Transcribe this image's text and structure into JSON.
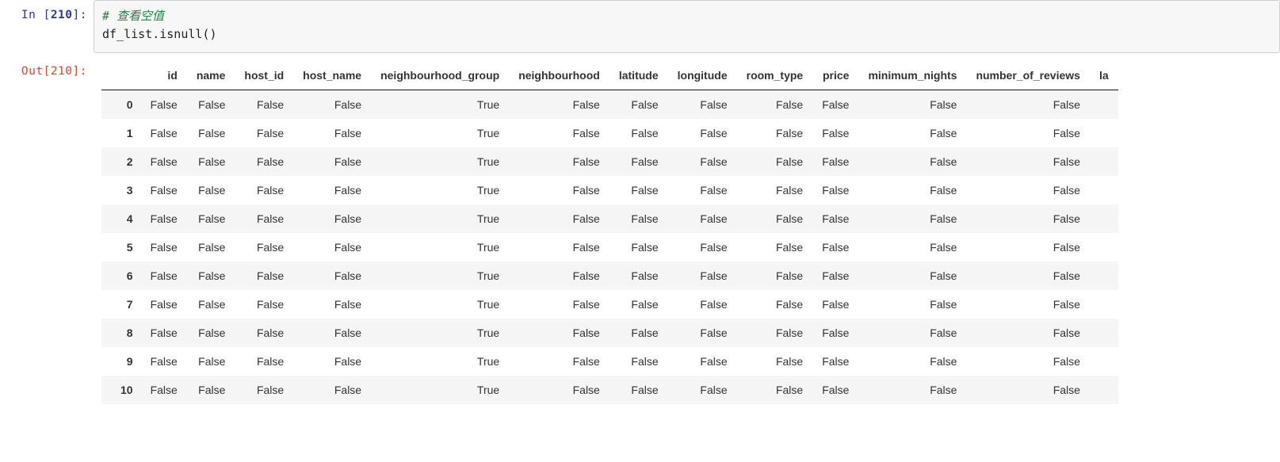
{
  "prompts": {
    "in_label": "In ",
    "out_label": "Out",
    "exec_count": "210"
  },
  "code": {
    "comment": "# 查看空值",
    "line": "df_list.isnull()"
  },
  "table": {
    "columns": [
      "id",
      "name",
      "host_id",
      "host_name",
      "neighbourhood_group",
      "neighbourhood",
      "latitude",
      "longitude",
      "room_type",
      "price",
      "minimum_nights",
      "number_of_reviews",
      "la"
    ],
    "index": [
      "0",
      "1",
      "2",
      "3",
      "4",
      "5",
      "6",
      "7",
      "8",
      "9",
      "10"
    ],
    "rows": [
      [
        "False",
        "False",
        "False",
        "False",
        "True",
        "False",
        "False",
        "False",
        "False",
        "False",
        "False",
        "False",
        ""
      ],
      [
        "False",
        "False",
        "False",
        "False",
        "True",
        "False",
        "False",
        "False",
        "False",
        "False",
        "False",
        "False",
        ""
      ],
      [
        "False",
        "False",
        "False",
        "False",
        "True",
        "False",
        "False",
        "False",
        "False",
        "False",
        "False",
        "False",
        ""
      ],
      [
        "False",
        "False",
        "False",
        "False",
        "True",
        "False",
        "False",
        "False",
        "False",
        "False",
        "False",
        "False",
        ""
      ],
      [
        "False",
        "False",
        "False",
        "False",
        "True",
        "False",
        "False",
        "False",
        "False",
        "False",
        "False",
        "False",
        ""
      ],
      [
        "False",
        "False",
        "False",
        "False",
        "True",
        "False",
        "False",
        "False",
        "False",
        "False",
        "False",
        "False",
        ""
      ],
      [
        "False",
        "False",
        "False",
        "False",
        "True",
        "False",
        "False",
        "False",
        "False",
        "False",
        "False",
        "False",
        ""
      ],
      [
        "False",
        "False",
        "False",
        "False",
        "True",
        "False",
        "False",
        "False",
        "False",
        "False",
        "False",
        "False",
        ""
      ],
      [
        "False",
        "False",
        "False",
        "False",
        "True",
        "False",
        "False",
        "False",
        "False",
        "False",
        "False",
        "False",
        ""
      ],
      [
        "False",
        "False",
        "False",
        "False",
        "True",
        "False",
        "False",
        "False",
        "False",
        "False",
        "False",
        "False",
        ""
      ],
      [
        "False",
        "False",
        "False",
        "False",
        "True",
        "False",
        "False",
        "False",
        "False",
        "False",
        "False",
        "False",
        ""
      ]
    ]
  }
}
